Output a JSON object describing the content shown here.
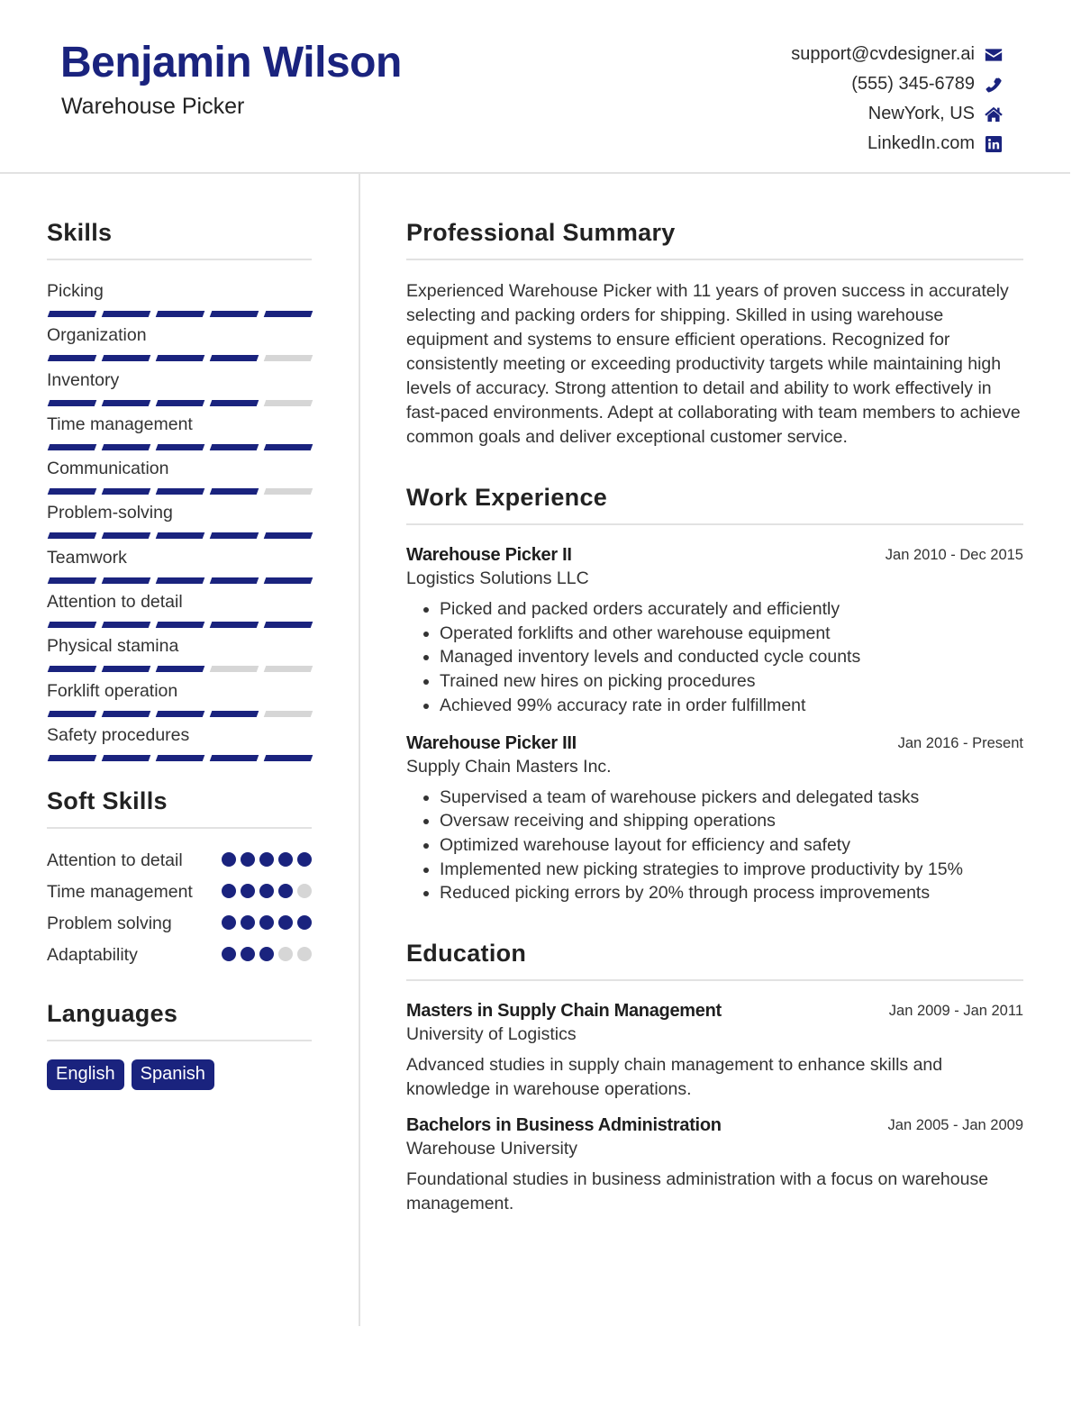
{
  "header": {
    "name": "Benjamin Wilson",
    "title": "Warehouse Picker",
    "contacts": [
      {
        "text": "support@cvdesigner.ai",
        "icon": "envelope-icon"
      },
      {
        "text": "(555) 345-6789",
        "icon": "phone-icon"
      },
      {
        "text": "NewYork, US",
        "icon": "home-icon"
      },
      {
        "text": "LinkedIn.com",
        "icon": "linkedin-icon"
      }
    ]
  },
  "colors": {
    "accent": "#1a237e",
    "inactive": "#d6d6d6",
    "divider": "#e2e2e2"
  },
  "skills": {
    "title": "Skills",
    "max_level": 5,
    "items": [
      {
        "label": "Picking",
        "level": 5
      },
      {
        "label": "Organization",
        "level": 4
      },
      {
        "label": "Inventory",
        "level": 4
      },
      {
        "label": "Time management",
        "level": 5
      },
      {
        "label": "Communication",
        "level": 4
      },
      {
        "label": "Problem-solving",
        "level": 5
      },
      {
        "label": "Teamwork",
        "level": 5
      },
      {
        "label": "Attention to detail",
        "level": 5
      },
      {
        "label": "Physical stamina",
        "level": 3
      },
      {
        "label": "Forklift operation",
        "level": 4
      },
      {
        "label": "Safety procedures",
        "level": 5
      }
    ]
  },
  "soft_skills": {
    "title": "Soft Skills",
    "max_level": 5,
    "items": [
      {
        "label": "Attention to detail",
        "level": 5
      },
      {
        "label": "Time management",
        "level": 4
      },
      {
        "label": "Problem solving",
        "level": 5
      },
      {
        "label": "Adaptability",
        "level": 3
      }
    ]
  },
  "languages": {
    "title": "Languages",
    "items": [
      "English",
      "Spanish"
    ]
  },
  "summary": {
    "title": "Professional Summary",
    "text": "Experienced Warehouse Picker with 11 years of proven success in accurately selecting and packing orders for shipping. Skilled in using warehouse equipment and systems to ensure efficient operations. Recognized for consistently meeting or exceeding productivity targets while maintaining high levels of accuracy. Strong attention to detail and ability to work effectively in fast-paced environments. Adept at collaborating with team members to achieve common goals and deliver exceptional customer service."
  },
  "experience": {
    "title": "Work Experience",
    "jobs": [
      {
        "role": "Warehouse Picker II",
        "dates": "Jan 2010 - Dec 2015",
        "company": "Logistics Solutions LLC",
        "bullets": [
          "Picked and packed orders accurately and efficiently",
          "Operated forklifts and other warehouse equipment",
          "Managed inventory levels and conducted cycle counts",
          "Trained new hires on picking procedures",
          "Achieved 99% accuracy rate in order fulfillment"
        ]
      },
      {
        "role": "Warehouse Picker III",
        "dates": "Jan 2016 - Present",
        "company": "Supply Chain Masters Inc.",
        "bullets": [
          "Supervised a team of warehouse pickers and delegated tasks",
          "Oversaw receiving and shipping operations",
          "Optimized warehouse layout for efficiency and safety",
          "Implemented new picking strategies to improve productivity by 15%",
          "Reduced picking errors by 20% through process improvements"
        ]
      }
    ]
  },
  "education": {
    "title": "Education",
    "items": [
      {
        "degree": "Masters in Supply Chain Management",
        "dates": "Jan 2009 - Jan 2011",
        "school": "University of Logistics",
        "description": "Advanced studies in supply chain management to enhance skills and knowledge in warehouse operations."
      },
      {
        "degree": "Bachelors in Business Administration",
        "dates": "Jan 2005 - Jan 2009",
        "school": "Warehouse University",
        "description": "Foundational studies in business administration with a focus on warehouse management."
      }
    ]
  }
}
